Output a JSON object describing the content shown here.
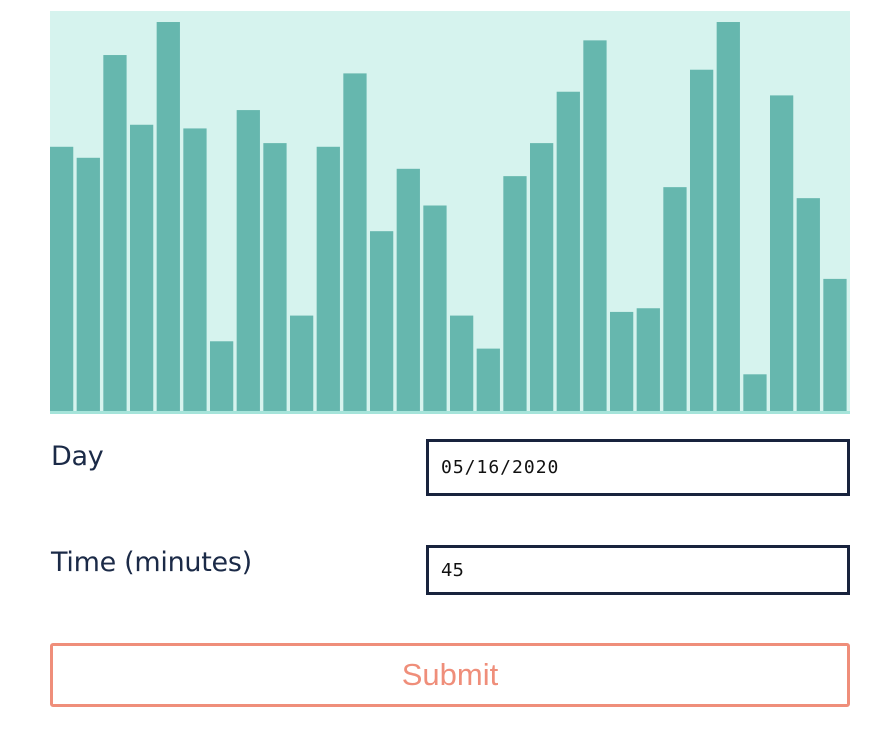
{
  "chart_data": {
    "type": "bar",
    "values": [
      72,
      69,
      97,
      78,
      106,
      77,
      19,
      82,
      73,
      26,
      72,
      92,
      49,
      66,
      56,
      26,
      17,
      64,
      73,
      87,
      101,
      27,
      28,
      61,
      93,
      106,
      10,
      86,
      58,
      36
    ],
    "ylim": [
      0,
      109
    ],
    "xlabel": "",
    "ylabel": "",
    "title": "",
    "grid": false,
    "colors": {
      "background": "#d6f3ee",
      "bar": "#66b7ae",
      "baseline": "#a5e4da"
    }
  },
  "form": {
    "day_label": "Day",
    "day_value": "05/16/2020",
    "time_label": "Time (minutes)",
    "time_value": "45",
    "submit_label": "Submit"
  },
  "colors": {
    "label_text": "#1b2a47",
    "input_border": "#18233d",
    "submit_accent": "#ef8e7a"
  }
}
